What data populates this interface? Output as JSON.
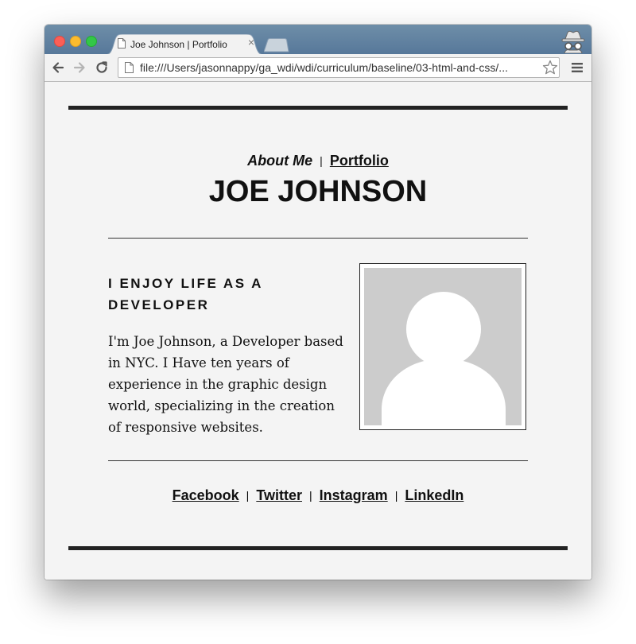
{
  "browser": {
    "tab_title": "Joe Johnson | Portfolio",
    "tab_close": "×",
    "url": "file:///Users/jasonnappy/ga_wdi/wdi/curriculum/baseline/03-html-and-css/..."
  },
  "nav": {
    "about": "About Me",
    "separator": "|",
    "portfolio": "Portfolio"
  },
  "page_title": "JOE JOHNSON",
  "about": {
    "headline": "I ENJOY LIFE AS A DEVELOPER",
    "bio": "I'm Joe Johnson, a Developer based in NYC. I Have ten years of experience in the graphic design world, specializing in the creation of responsive websites."
  },
  "social": {
    "links": [
      "Facebook",
      "Twitter",
      "Instagram",
      "LinkedIn"
    ],
    "separator": "|"
  },
  "colors": {
    "titlebar": "#5f7f9f",
    "page_bg": "#f4f4f4",
    "rule": "#222222",
    "avatar_bg": "#cccccc"
  }
}
